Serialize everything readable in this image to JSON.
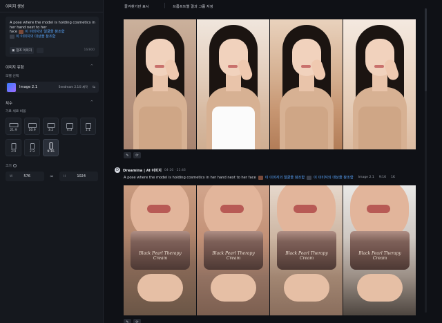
{
  "sidebar": {
    "tab_label": "이미지 생성",
    "prompt": {
      "line1": "A pose where the model is holding cosmetics in",
      "line2": "her hand next to her",
      "line3": "face",
      "ref1": "이 이미지의 얼굴을 참조함",
      "ref2": "이 이미지의 대상을 참조함",
      "ref_image_button": "참조 이미지",
      "count": "16/800"
    },
    "image_type": {
      "title": "이미지 유형",
      "caret": "^",
      "model_select_label": "모델 선택",
      "model_name": "Image 2.1",
      "model_version": "Seedream 2.1로 제작",
      "config_icon": "⇆"
    },
    "size_section": {
      "title": "치수",
      "caret": "^",
      "aspect_label": "가로 세로 비율",
      "ratios": [
        {
          "label": "21:9"
        },
        {
          "label": "16:9"
        },
        {
          "label": "3:2"
        },
        {
          "label": "4:3"
        },
        {
          "label": "1:1"
        },
        {
          "label": "3:4"
        },
        {
          "label": "2:3"
        },
        {
          "label": "9:16"
        }
      ],
      "selected_ratio": "9:16",
      "size_label": "크기",
      "width_prefix": "W",
      "width_value": "576",
      "height_prefix": "H",
      "height_value": "1024",
      "link_icon": "∞"
    }
  },
  "topbar": {
    "tab1": "즐겨찾기만 표시",
    "tab2": "프롬프트별 결과 그룹 지정"
  },
  "main": {
    "message": {
      "avatar_letter": "D",
      "author": "Dreamina | AI 이미지",
      "time": "04-26 · 21:46",
      "prompt_text": "A pose where the model is holding cosmetics in her hand next to her face",
      "ref1": "이 이미지의 얼굴을 참조함",
      "ref2": "이 이미지의 대상을 참조함",
      "meta_model": "Image 2.1",
      "meta_ratio": "9:16",
      "meta_res": "1K"
    },
    "jar_label": "Black Pearl Therapy Cream",
    "action_edit": "✎",
    "action_regen": "⟳"
  }
}
